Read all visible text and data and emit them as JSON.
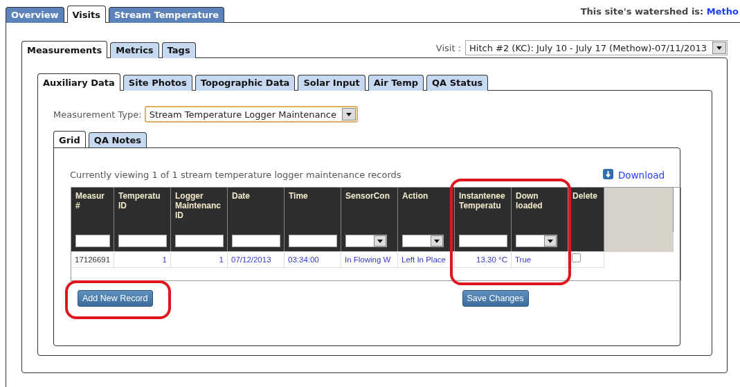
{
  "main_tabs": [
    {
      "label": "Overview",
      "selected": false
    },
    {
      "label": "Visits",
      "selected": true
    },
    {
      "label": "Stream Temperature",
      "selected": false
    }
  ],
  "watershed": {
    "label": "This site's watershed is:",
    "value": "Metho"
  },
  "visit_tabs": [
    {
      "label": "Measurements",
      "selected": true
    },
    {
      "label": "Metrics",
      "selected": false
    },
    {
      "label": "Tags",
      "selected": false
    }
  ],
  "visit": {
    "label": "Visit :",
    "value": "Hitch #2 (KC): July 10 - July 17 (Methow)-07/11/2013"
  },
  "measurement_tabs": [
    {
      "label": "Auxiliary Data",
      "selected": true
    },
    {
      "label": "Site Photos",
      "selected": false
    },
    {
      "label": "Topographic Data",
      "selected": false
    },
    {
      "label": "Solar Input",
      "selected": false
    },
    {
      "label": "Air Temp",
      "selected": false
    },
    {
      "label": "QA Status",
      "selected": false
    }
  ],
  "measurement_type": {
    "label": "Measurement Type:",
    "value": "Stream Temperature Logger Maintenance"
  },
  "grid_tabs": [
    {
      "label": "Grid",
      "selected": true
    },
    {
      "label": "QA Notes",
      "selected": false
    }
  ],
  "summary": "Currently viewing 1 of 1 stream temperature logger maintenance records",
  "download": "Download",
  "table": {
    "columns": [
      {
        "label": "Measur\n#",
        "kind": "text",
        "highlighted": false
      },
      {
        "label": "Temperatu\nID",
        "kind": "text",
        "highlighted": false
      },
      {
        "label": "Logger\nMaintenanc\nID",
        "kind": "text",
        "highlighted": false
      },
      {
        "label": "Date",
        "kind": "text",
        "highlighted": false
      },
      {
        "label": "Time",
        "kind": "text",
        "highlighted": false
      },
      {
        "label": "SensorCon",
        "kind": "select",
        "highlighted": false
      },
      {
        "label": "Action",
        "kind": "select",
        "highlighted": false
      },
      {
        "label": "Instantenee\nTemperatu",
        "kind": "text",
        "highlighted": true
      },
      {
        "label": "Down\nloaded",
        "kind": "select",
        "highlighted": true
      },
      {
        "label": "Delete",
        "kind": "checkbox",
        "highlighted": false
      }
    ],
    "rows": [
      {
        "cells": [
          "17126691",
          "1",
          "1",
          "07/12/2013",
          "03:34:00",
          "In Flowing W",
          "Left In Place",
          "13.30 °C",
          "True"
        ],
        "delete_checked": false
      }
    ]
  },
  "buttons": [
    {
      "label": "Add New Record",
      "highlighted": true
    },
    {
      "label": "Save Changes",
      "highlighted": false
    }
  ]
}
